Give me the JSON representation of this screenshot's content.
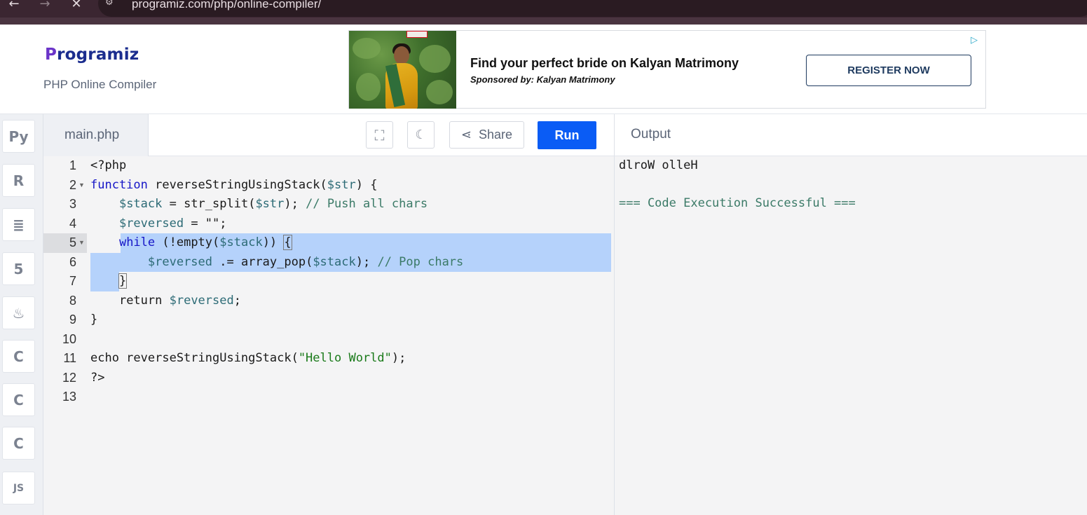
{
  "browser": {
    "url": "programiz.com/php/online-compiler/",
    "back_icon": "arrow-left-icon",
    "forward_icon": "arrow-right-icon",
    "close_icon": "close-icon"
  },
  "header": {
    "logo_text": "rogramiz",
    "logo_mark": "P",
    "subtitle": "PHP Online Compiler"
  },
  "ad": {
    "title": "Find your perfect bride on Kalyan Matrimony",
    "sponsor": "Sponsored by: Kalyan Matrimony",
    "button": "REGISTER NOW"
  },
  "languages": [
    "python-icon",
    "r-icon",
    "database-icon",
    "html5-icon",
    "java-icon",
    "c-icon",
    "cpp-icon",
    "csharp-icon",
    "js-icon"
  ],
  "editor": {
    "filename": "main.php",
    "share_label": "Share",
    "run_label": "Run",
    "line_numbers": [
      "1",
      "2",
      "3",
      "4",
      "5",
      "6",
      "7",
      "8",
      "9",
      "10",
      "11",
      "12",
      "13"
    ]
  },
  "code": {
    "l1": "<?php",
    "l2_kw": "function",
    "l2_name": " reverseStringUsingStack(",
    "l2_var": "$str",
    "l2_end": ") {",
    "l3_var": "$stack",
    "l3_mid": " = str_split(",
    "l3_var2": "$str",
    "l3_end": "); ",
    "l3_cm": "// Push all chars",
    "l4_var": "$reversed",
    "l4_end": " = \"\";",
    "l5_kw": "while",
    "l5_mid": " (!empty(",
    "l5_var": "$stack",
    "l5_end": ")) ",
    "l5_brace": "{",
    "l6_var": "$reversed",
    "l6_mid": " .= array_pop(",
    "l6_var2": "$stack",
    "l6_end": "); ",
    "l6_cm": "// Pop chars",
    "l7": "}",
    "l8_kw": "return ",
    "l8_var": "$reversed",
    "l8_end": ";",
    "l9": "}",
    "l11_a": "echo reverseStringUsingStack(",
    "l11_str": "\"Hello World\"",
    "l11_end": ");",
    "l12": "?>"
  },
  "output": {
    "title": "Output",
    "line1": "dlroW olleH",
    "line2": "=== Code Execution Successful ==="
  }
}
